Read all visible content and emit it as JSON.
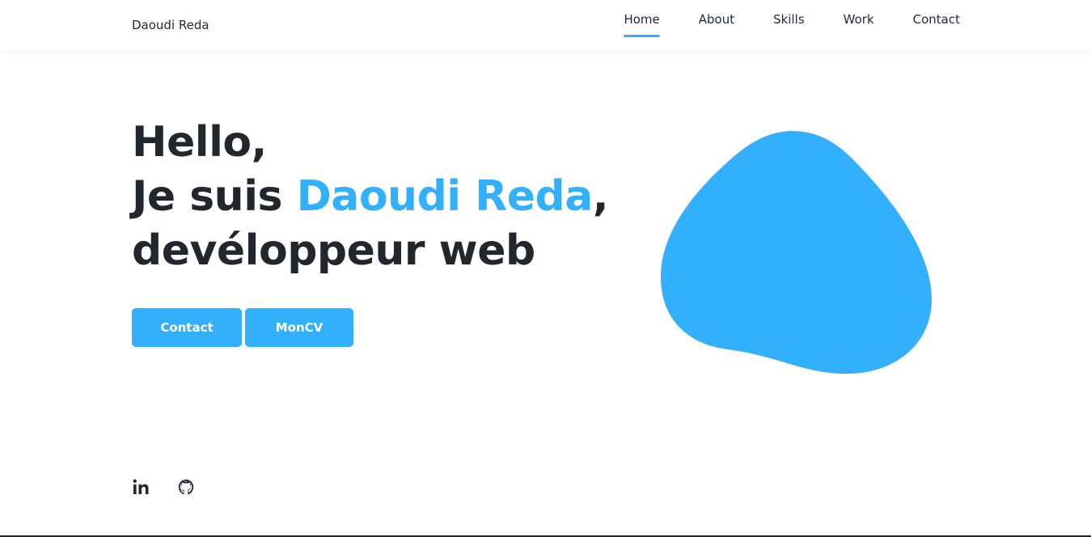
{
  "brand": {
    "name": "Daoudi Reda"
  },
  "nav": {
    "items": [
      {
        "label": "Home",
        "active": true
      },
      {
        "label": "About",
        "active": false
      },
      {
        "label": "Skills",
        "active": false
      },
      {
        "label": "Work",
        "active": false
      },
      {
        "label": "Contact",
        "active": false
      }
    ]
  },
  "hero": {
    "line1": "Hello,",
    "line2_prefix": "Je suis ",
    "line2_name": "Daoudi Reda",
    "line2_suffix": ",",
    "line3": "devéloppeur web"
  },
  "buttons": {
    "contact_label": "Contact",
    "cv_label": "MonCV"
  },
  "social": {
    "icons": [
      "linkedin-icon",
      "github-icon"
    ]
  },
  "colors": {
    "accent": "#32b0fb",
    "text": "#22272e",
    "background": "#ffffff"
  }
}
